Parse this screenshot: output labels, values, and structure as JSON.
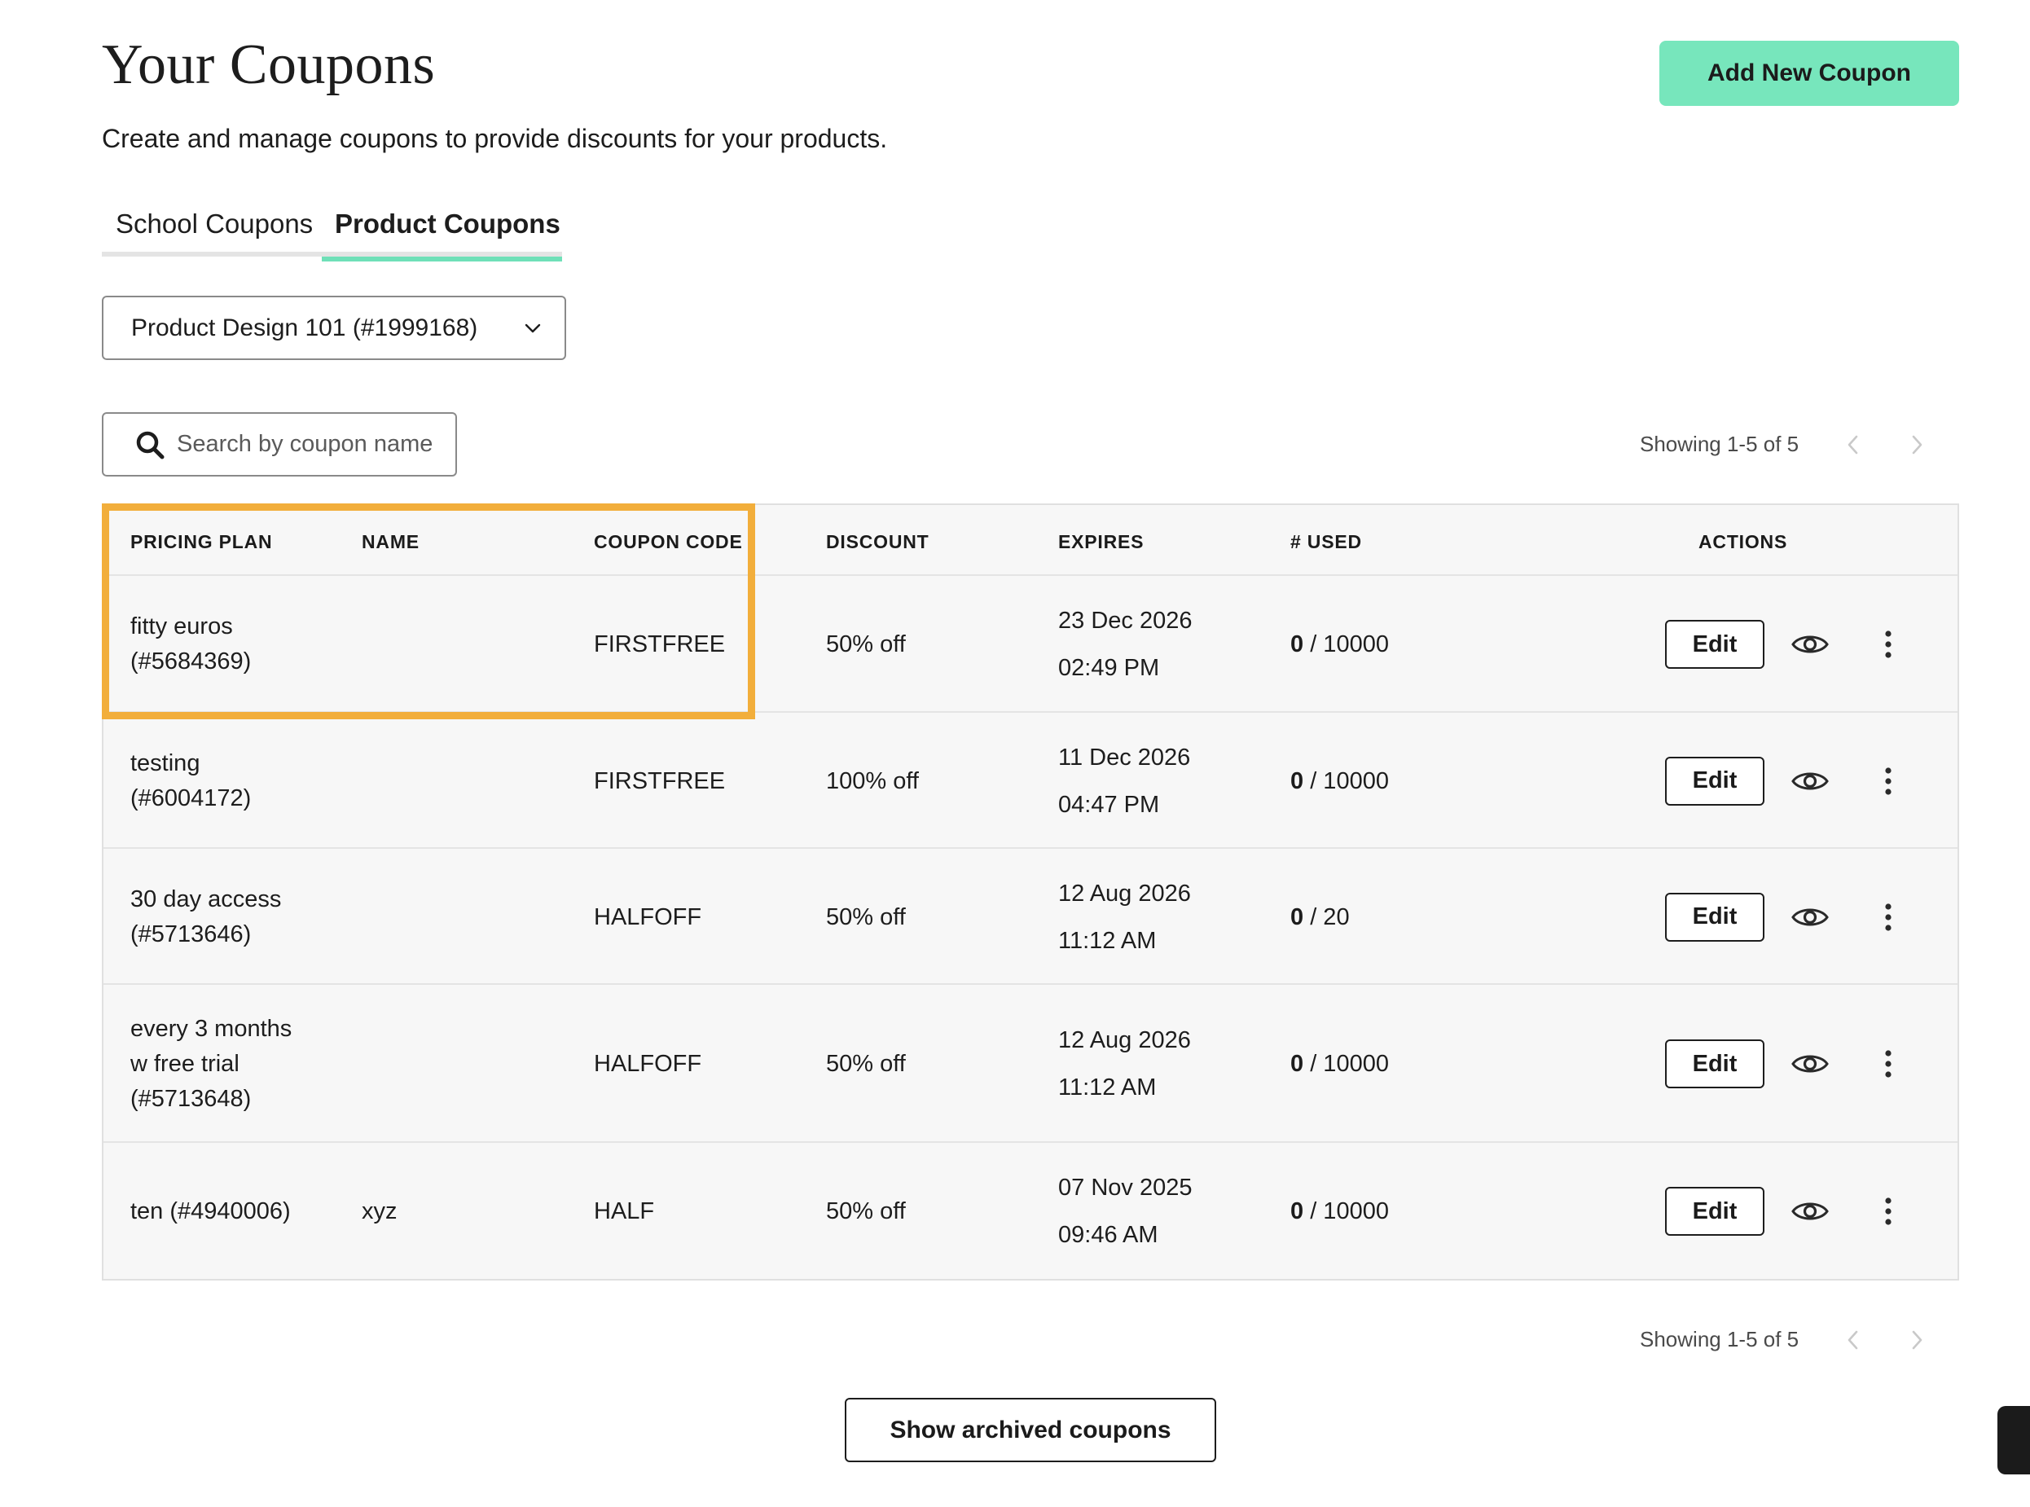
{
  "header": {
    "title": "Your Coupons",
    "subtitle": "Create and manage coupons to provide discounts for your products.",
    "add_button": "Add New Coupon"
  },
  "tabs": [
    {
      "label": "School Coupons",
      "active": false
    },
    {
      "label": "Product Coupons",
      "active": true
    }
  ],
  "product_select": {
    "value": "Product Design 101 (#1999168)"
  },
  "search": {
    "placeholder": "Search by coupon name",
    "value": ""
  },
  "pagination": {
    "label": "Showing 1-5 of 5"
  },
  "table": {
    "columns": [
      "PRICING PLAN",
      "NAME",
      "COUPON CODE",
      "DISCOUNT",
      "EXPIRES",
      "# USED",
      "ACTIONS"
    ],
    "rows": [
      {
        "plan": "fitty euros\n(#5684369)",
        "name": "",
        "code": "FIRSTFREE",
        "discount": "50% off",
        "expires_date": "23 Dec 2026",
        "expires_time": "02:49 PM",
        "used": "0",
        "limit": " / 10000",
        "edit": "Edit"
      },
      {
        "plan": "testing\n(#6004172)",
        "name": "",
        "code": "FIRSTFREE",
        "discount": "100% off",
        "expires_date": "11 Dec 2026",
        "expires_time": "04:47 PM",
        "used": "0",
        "limit": " / 10000",
        "edit": "Edit"
      },
      {
        "plan": "30 day access\n(#5713646)",
        "name": "",
        "code": "HALFOFF",
        "discount": "50% off",
        "expires_date": "12 Aug 2026",
        "expires_time": "11:12 AM",
        "used": "0",
        "limit": " / 20",
        "edit": "Edit"
      },
      {
        "plan": "every 3 months\nw free trial\n(#5713648)",
        "name": "",
        "code": "HALFOFF",
        "discount": "50% off",
        "expires_date": "12 Aug 2026",
        "expires_time": "11:12 AM",
        "used": "0",
        "limit": " / 10000",
        "edit": "Edit"
      },
      {
        "plan": "ten (#4940006)",
        "name": "xyz",
        "code": "HALF",
        "discount": "50% off",
        "expires_date": "07 Nov 2025",
        "expires_time": "09:46 AM",
        "used": "0",
        "limit": " / 10000",
        "edit": "Edit"
      }
    ]
  },
  "archived_button": "Show archived coupons",
  "colors": {
    "accent": "#77e6bc",
    "tab_underline": "#6fe0b8",
    "highlight": "#f2ae3b",
    "table_bg": "#f7f7f7"
  },
  "icons": [
    "search-icon",
    "chevron-down-icon",
    "chevron-left-icon",
    "chevron-right-icon",
    "eye-icon",
    "more-vertical-icon"
  ]
}
